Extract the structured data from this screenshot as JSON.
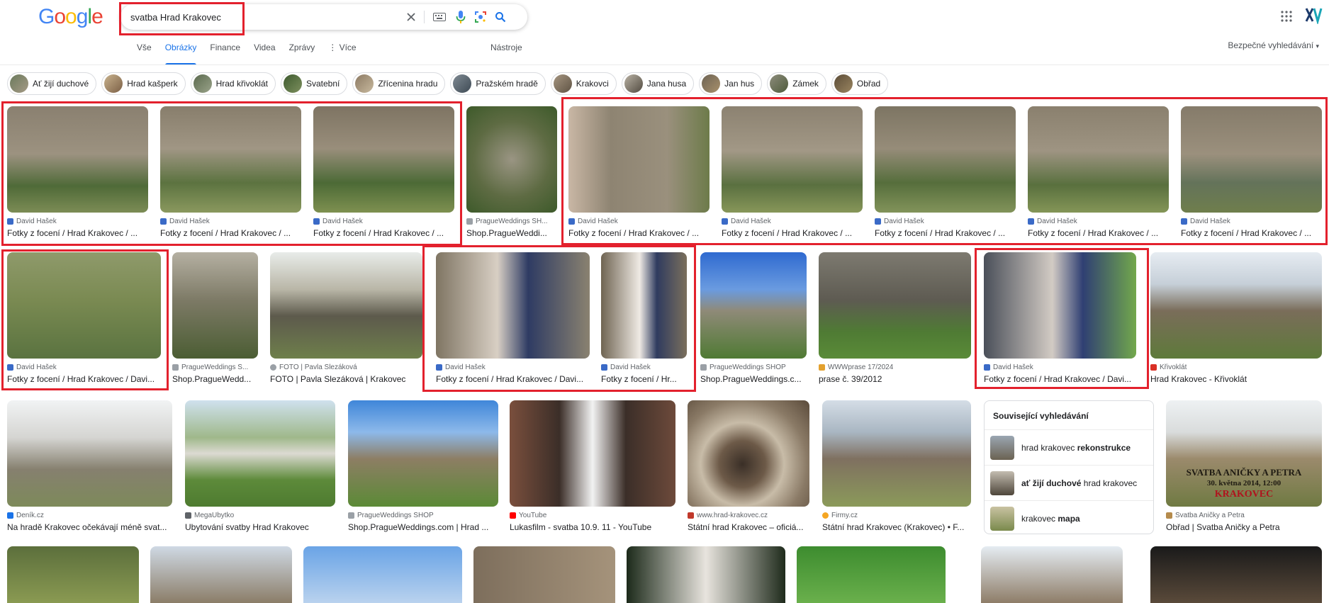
{
  "search": {
    "query": "svatba Hrad Krakovec"
  },
  "logo": {
    "letters": [
      "G",
      "o",
      "o",
      "g",
      "l",
      "e"
    ],
    "colors": [
      "#4285f4",
      "#ea4335",
      "#fbbc05",
      "#4285f4",
      "#34a853",
      "#ea4335"
    ]
  },
  "tabs": [
    {
      "label": "Vše"
    },
    {
      "label": "Obrázky"
    },
    {
      "label": "Finance"
    },
    {
      "label": "Videa"
    },
    {
      "label": "Zprávy"
    },
    {
      "label": "⋮ Více"
    }
  ],
  "tools_label": "Nástroje",
  "safe_search_label": "Bezpečné vyhledávání",
  "chips": [
    {
      "label": "Ať žijí duchové"
    },
    {
      "label": "Hrad kašperk"
    },
    {
      "label": "Hrad křivoklát"
    },
    {
      "label": "Svatební"
    },
    {
      "label": "Zřícenina hradu"
    },
    {
      "label": "Pražském hradě"
    },
    {
      "label": "Krakovci"
    },
    {
      "label": "Jana husa"
    },
    {
      "label": "Jan hus"
    },
    {
      "label": "Zámek"
    },
    {
      "label": "Obřad"
    }
  ],
  "results": [
    {
      "source": "David Hašek",
      "caption": "Fotky z focení / Hrad Krakovec / ..."
    },
    {
      "source": "David Hašek",
      "caption": "Fotky z focení / Hrad Krakovec / ..."
    },
    {
      "source": "David Hašek",
      "caption": "Fotky z focení / Hrad Krakovec / ..."
    },
    {
      "source": "PragueWeddings SH...",
      "caption": "Shop.PragueWeddi..."
    },
    {
      "source": "David Hašek",
      "caption": "Fotky z focení / Hrad Krakovec / ..."
    },
    {
      "source": "David Hašek",
      "caption": "Fotky z focení / Hrad Krakovec / ..."
    },
    {
      "source": "David Hašek",
      "caption": "Fotky z focení / Hrad Krakovec / ..."
    },
    {
      "source": "David Hašek",
      "caption": "Fotky z focení / Hrad Krakovec / ..."
    },
    {
      "source": "David Hašek",
      "caption": "Fotky z focení / Hrad Krakovec / ..."
    },
    {
      "source": "David Hašek",
      "caption": "Fotky z focení / Hrad Krakovec / Davi..."
    },
    {
      "source": "PragueWeddings S...",
      "caption": "Shop.PragueWedd..."
    },
    {
      "source": "FOTO | Pavla Slezáková",
      "caption": "FOTO | Pavla Slezáková | Krakovec"
    },
    {
      "source": "David Hašek",
      "caption": "Fotky z focení / Hrad Krakovec / Davi..."
    },
    {
      "source": "David Hašek",
      "caption": "Fotky z focení / Hr..."
    },
    {
      "source": "PragueWeddings SHOP",
      "caption": "Shop.PragueWeddings.c..."
    },
    {
      "source": "WWWprase 17/2024",
      "caption": "prase č. 39/2012"
    },
    {
      "source": "David Hašek",
      "caption": "Fotky z focení / Hrad Krakovec / Davi..."
    },
    {
      "source": "Křivoklát",
      "caption": "Hrad Krakovec - Křivoklát"
    },
    {
      "source": "Deník.cz",
      "caption": "Na hradě Krakovec očekávají méně svat..."
    },
    {
      "source": "MegaUbytko",
      "caption": "Ubytování svatby Hrad Krakovec"
    },
    {
      "source": "PragueWeddings SHOP",
      "caption": "Shop.PragueWeddings.com | Hrad ..."
    },
    {
      "source": "YouTube",
      "caption": "Lukasfilm - svatba 10.9. 11 - YouTube"
    },
    {
      "source": "www.hrad-krakovec.cz",
      "caption": "Státní hrad Krakovec – oficiá..."
    },
    {
      "source": "Firmy.cz",
      "caption": "Státní hrad Krakovec (Krakovec) • F..."
    },
    {
      "source": "Svatba Aničky a Petra",
      "caption": "Obřad | Svatba Aničky a Petra"
    }
  ],
  "related": {
    "title": "Související vyhledávání",
    "items": [
      {
        "plain": "hrad krakovec ",
        "bold": "rekonstrukce",
        "plain_after": ""
      },
      {
        "plain": "",
        "bold": "ať žijí duchové",
        "plain_after": " hrad krakovec"
      },
      {
        "plain": "krakovec ",
        "bold": "mapa",
        "plain_after": ""
      }
    ]
  },
  "overlay_text": {
    "line1": "SVATBA ANIČKY A PETRA",
    "line2": "30. května 2014, 12:00",
    "line3": "KRAKOVEC"
  }
}
